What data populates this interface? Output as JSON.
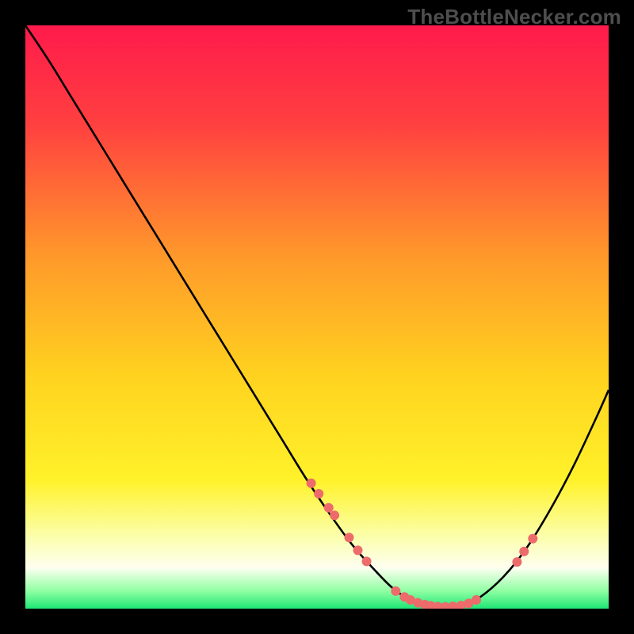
{
  "watermark": "TheBottleNecker.com",
  "chart_data": {
    "type": "line",
    "title": "",
    "xlabel": "",
    "ylabel": "",
    "xlim": [
      0,
      100
    ],
    "ylim": [
      0,
      100
    ],
    "grid": false,
    "background_gradient": {
      "orientation": "vertical",
      "stops": [
        {
          "pos": 0.0,
          "color": "#ff1a4b"
        },
        {
          "pos": 0.17,
          "color": "#ff4040"
        },
        {
          "pos": 0.4,
          "color": "#ff9a2a"
        },
        {
          "pos": 0.6,
          "color": "#ffd21f"
        },
        {
          "pos": 0.78,
          "color": "#fff22a"
        },
        {
          "pos": 0.88,
          "color": "#fbffb0"
        },
        {
          "pos": 0.93,
          "color": "#fefff0"
        },
        {
          "pos": 0.97,
          "color": "#8effa2"
        },
        {
          "pos": 1.0,
          "color": "#1fe676"
        }
      ]
    },
    "series": [
      {
        "name": "bottleneck-curve",
        "color": "#000000",
        "x": [
          0,
          4,
          8,
          12,
          16,
          20,
          24,
          28,
          32,
          36,
          40,
          44,
          48,
          52,
          56,
          60,
          63,
          66,
          69,
          72,
          75,
          78,
          82,
          86,
          90,
          94,
          98,
          100
        ],
        "y": [
          100,
          94,
          87.5,
          81,
          74.5,
          68,
          61.5,
          55,
          48.5,
          42,
          35.5,
          29,
          22.5,
          16.5,
          11,
          6.5,
          3.5,
          1.5,
          0.6,
          0.3,
          0.6,
          2.0,
          5.5,
          10.5,
          17,
          24.5,
          33,
          37.5
        ]
      }
    ],
    "markers": {
      "name": "highlighted-points",
      "color": "#ed6b6b",
      "radius_px": 6,
      "points": [
        {
          "x": 49.0,
          "y": 21.5
        },
        {
          "x": 50.3,
          "y": 19.7
        },
        {
          "x": 52.0,
          "y": 17.3
        },
        {
          "x": 53.0,
          "y": 16.0
        },
        {
          "x": 55.5,
          "y": 12.2
        },
        {
          "x": 57.0,
          "y": 10.0
        },
        {
          "x": 58.5,
          "y": 8.1
        },
        {
          "x": 63.5,
          "y": 3.0
        },
        {
          "x": 65.0,
          "y": 2.0
        },
        {
          "x": 66.0,
          "y": 1.5
        },
        {
          "x": 67.3,
          "y": 1.0
        },
        {
          "x": 68.5,
          "y": 0.7
        },
        {
          "x": 69.5,
          "y": 0.5
        },
        {
          "x": 70.7,
          "y": 0.35
        },
        {
          "x": 72.0,
          "y": 0.3
        },
        {
          "x": 73.3,
          "y": 0.4
        },
        {
          "x": 74.7,
          "y": 0.55
        },
        {
          "x": 76.0,
          "y": 0.9
        },
        {
          "x": 77.3,
          "y": 1.5
        },
        {
          "x": 84.3,
          "y": 8.0
        },
        {
          "x": 85.5,
          "y": 9.8
        },
        {
          "x": 87.0,
          "y": 12.0
        }
      ]
    }
  }
}
